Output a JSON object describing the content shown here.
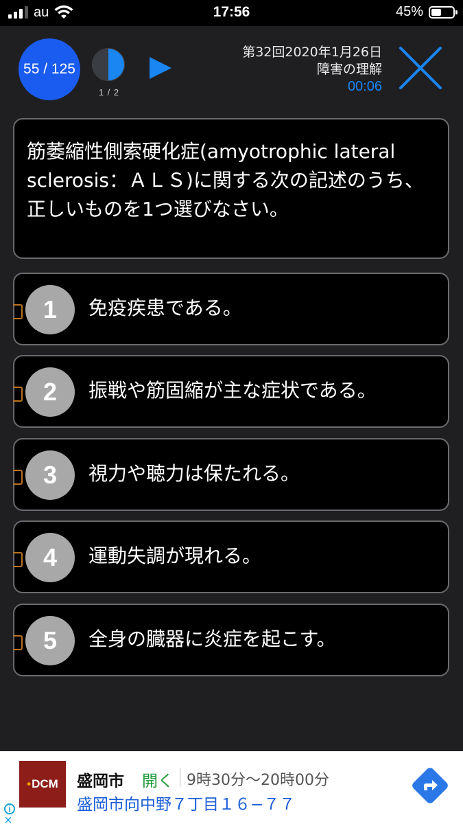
{
  "status_bar": {
    "carrier": "au",
    "time": "17:56",
    "battery_percent": "45%",
    "battery_level": 0.45,
    "signal_bars": 3
  },
  "header": {
    "counter": "55 / 125",
    "pie_label": "1 / 2",
    "exam_title": "第32回2020年1月26日",
    "subject": "障害の理解",
    "timer": "00:06"
  },
  "question": {
    "text": "筋萎縮性側索硬化症(amyotrophic lateral sclerosis：ＡＬＳ)に関する次の記述のうち、正しいものを1つ選びなさい。"
  },
  "choices": [
    {
      "number": "1",
      "text": "免疫疾患である。"
    },
    {
      "number": "2",
      "text": "振戦や筋固縮が主な症状である。"
    },
    {
      "number": "3",
      "text": "視力や聴力は保たれる。"
    },
    {
      "number": "4",
      "text": "運動失調が現れる。"
    },
    {
      "number": "5",
      "text": "全身の臓器に炎症を起こす。"
    }
  ],
  "ad": {
    "logo": "DCM",
    "name": "盛岡市",
    "open_label": "開く",
    "hours": "9時30分～20時00分",
    "address": "盛岡市向中野７丁目１６−７７"
  },
  "colors": {
    "accent_blue": "#1a86f2",
    "counter_blue": "#1a5cf0",
    "background": "#1f1f22",
    "card_border": "#6b6b6f"
  }
}
